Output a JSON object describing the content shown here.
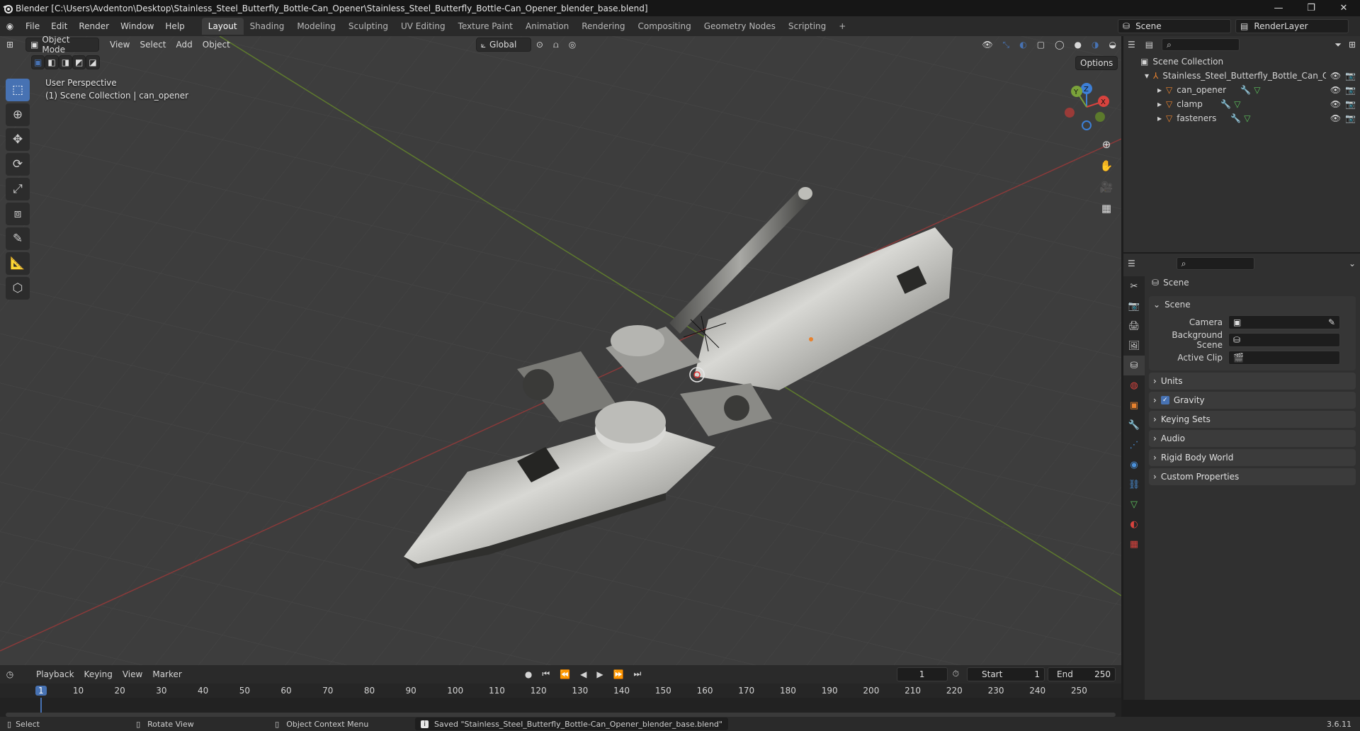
{
  "window": {
    "title": "Blender [C:\\Users\\Avdenton\\Desktop\\Stainless_Steel_Butterfly_Bottle-Can_Opener\\Stainless_Steel_Butterfly_Bottle-Can_Opener_blender_base.blend]",
    "min": "—",
    "max": "❐",
    "close": "✕"
  },
  "menu": [
    "File",
    "Edit",
    "Render",
    "Window",
    "Help"
  ],
  "workspaces": [
    "Layout",
    "Shading",
    "Modeling",
    "Sculpting",
    "UV Editing",
    "Texture Paint",
    "Animation",
    "Rendering",
    "Compositing",
    "Geometry Nodes",
    "Scripting"
  ],
  "scene": {
    "name": "Scene",
    "render_layer": "RenderLayer"
  },
  "viewport_header": {
    "mode": "Object Mode",
    "view": "View",
    "select": "Select",
    "add": "Add",
    "object": "Object",
    "orientation": "Global",
    "options": "Options"
  },
  "viewport": {
    "perspective": "User Perspective",
    "collection": "(1) Scene Collection | can_opener"
  },
  "gizmo": {
    "x": "X",
    "y": "Y",
    "z": "Z"
  },
  "outliner": {
    "root": "Scene Collection",
    "collection": "Stainless_Steel_Butterfly_Bottle_Can_Op",
    "objects": [
      "can_opener",
      "clamp",
      "fasteners"
    ]
  },
  "properties": {
    "context": "Scene",
    "section": "Scene",
    "camera_label": "Camera",
    "bg_scene_label": "Background Scene",
    "active_clip_label": "Active Clip",
    "panels": [
      "Units",
      "Gravity",
      "Keying Sets",
      "Audio",
      "Rigid Body World",
      "Custom Properties"
    ],
    "gravity_checked": true
  },
  "timeline": {
    "menus": [
      "Playback",
      "Keying",
      "View",
      "Marker"
    ],
    "current_frame": "1",
    "start_label": "Start",
    "start": "1",
    "end_label": "End",
    "end": "250",
    "ticks": [
      "1",
      "10",
      "20",
      "30",
      "40",
      "50",
      "60",
      "70",
      "80",
      "90",
      "100",
      "110",
      "120",
      "130",
      "140",
      "150",
      "160",
      "170",
      "180",
      "190",
      "200",
      "210",
      "220",
      "230",
      "240",
      "250"
    ]
  },
  "status": {
    "select": "Select",
    "rotate": "Rotate View",
    "context_menu": "Object Context Menu",
    "message": "Saved \"Stainless_Steel_Butterfly_Bottle-Can_Opener_blender_base.blend\"",
    "version": "3.6.11"
  },
  "colors": {
    "accent": "#4772b3",
    "x_axis": "#d8433e",
    "y_axis": "#7aa23a",
    "z_axis": "#3d7fd6",
    "orange": "#e8822e"
  }
}
